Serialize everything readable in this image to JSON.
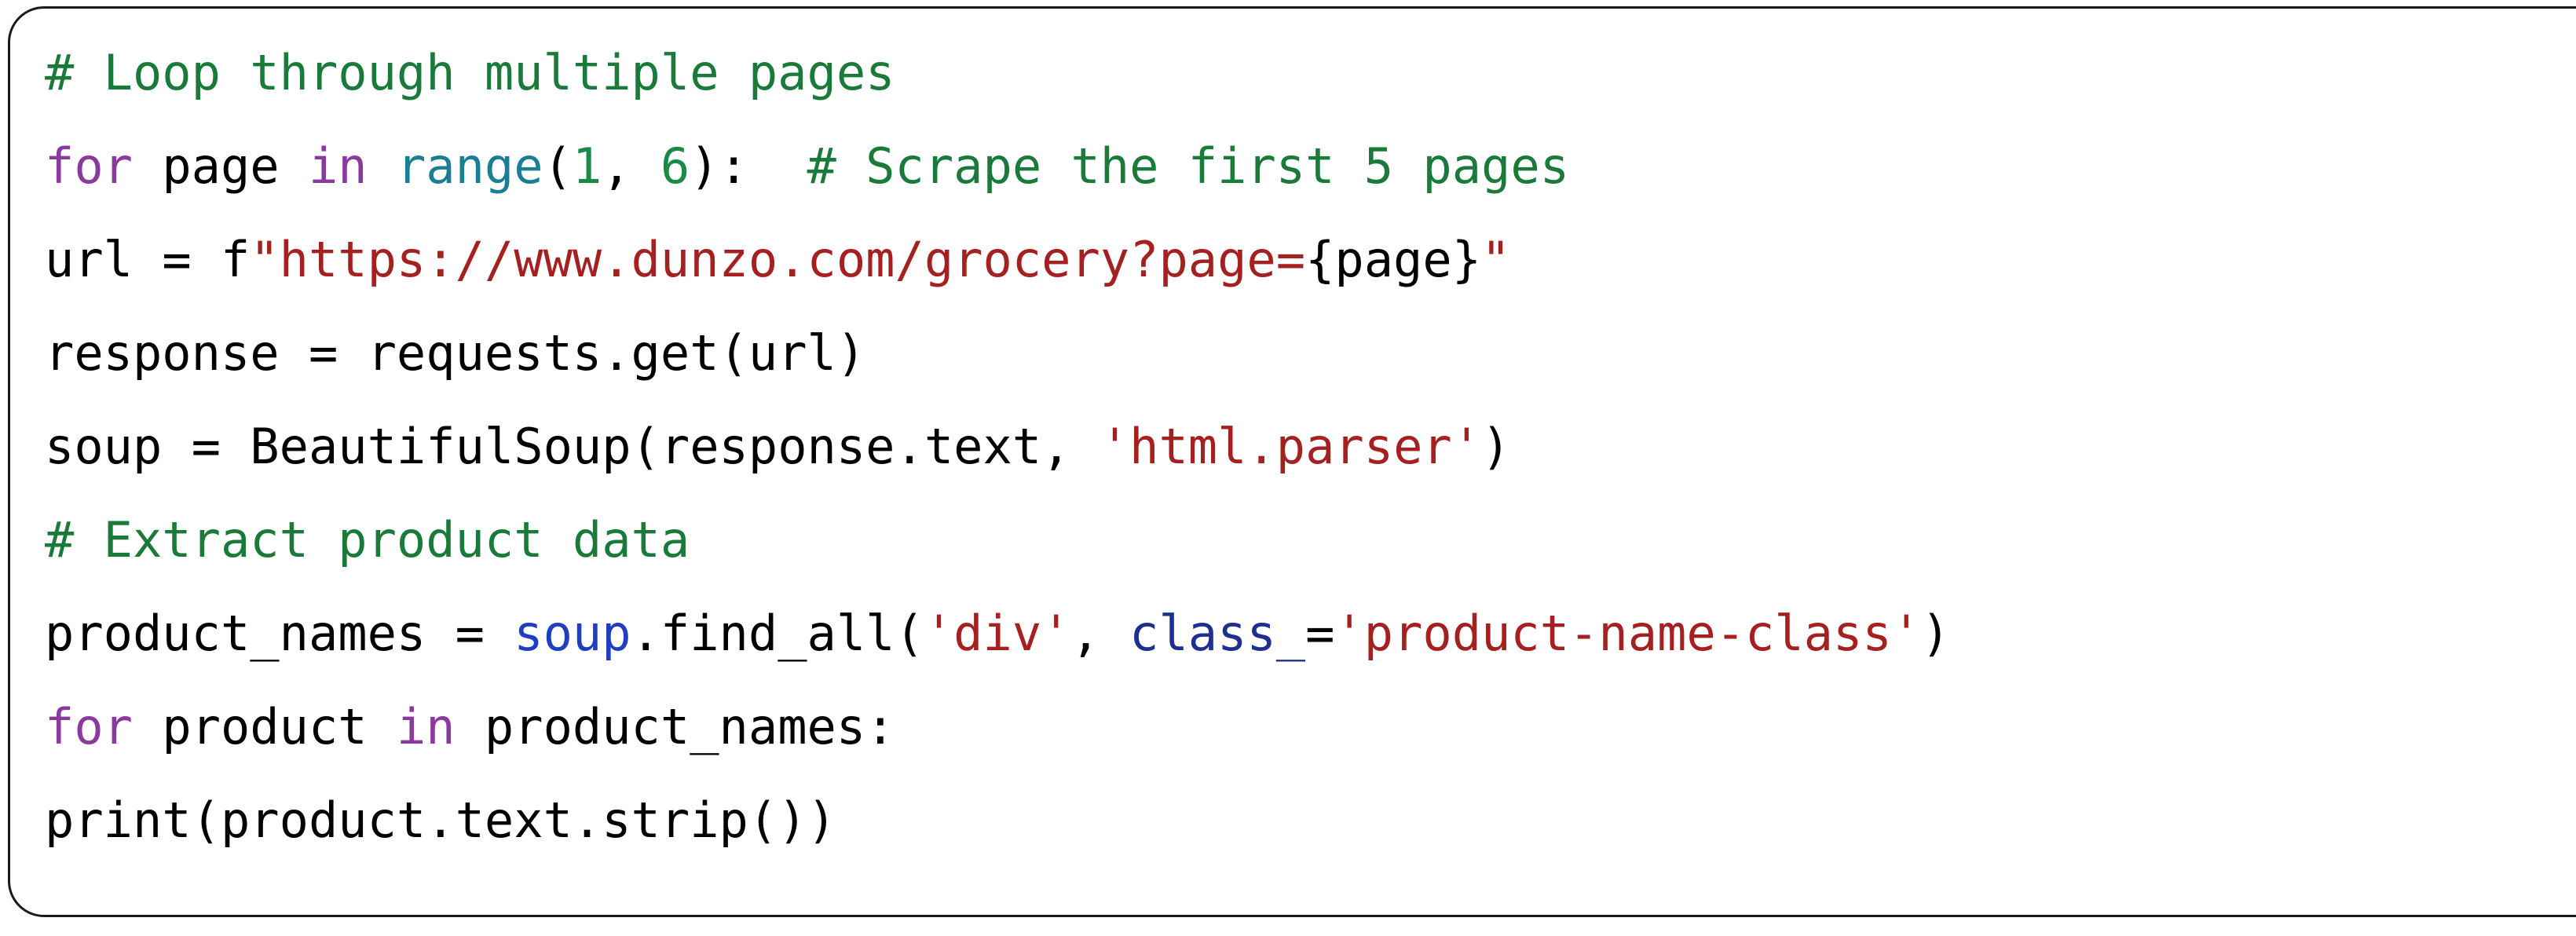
{
  "card": {
    "language": "python",
    "border_color": "#1a1a1a",
    "background_color": "#ffffff"
  },
  "colors": {
    "comment": "#1a7a3a",
    "keyword": "#8a3a9e",
    "variable": "#2b3a8c",
    "builtin": "#1a7f93",
    "number": "#1a8a4a",
    "string": "#a52121",
    "fstring_prefix": "#1f53c4",
    "interpolation": "#1f53c4",
    "kwarg": "#1f2f8f",
    "print_builtin": "#8a6d1f",
    "plain": "#000000"
  },
  "code": {
    "plain_text": "# Loop through multiple pages\nfor page in range(1, 6):  # Scrape the first 5 pages\nurl = f\"https://www.dunzo.com/grocery?page={page}\"\nresponse = requests.get(url)\nsoup = BeautifulSoup(response.text, 'html.parser')\n# Extract product data\nproduct_names = soup.find_all('div', class_='product-name-class')\nfor product in product_names:\nprint(product.text.strip())",
    "lines": [
      {
        "index": 1,
        "text": "# Loop through multiple pages",
        "tokens": [
          {
            "t": "# Loop through multiple pages",
            "c": "comment"
          }
        ]
      },
      {
        "index": 2,
        "text": "for page in range(1, 6):  # Scrape the first 5 pages",
        "tokens": [
          {
            "t": "for",
            "c": "keyword"
          },
          {
            "t": " ",
            "c": "plain"
          },
          {
            "t": "page",
            "c": "variable"
          },
          {
            "t": " ",
            "c": "plain"
          },
          {
            "t": "in",
            "c": "keyword"
          },
          {
            "t": " ",
            "c": "plain"
          },
          {
            "t": "range",
            "c": "builtin"
          },
          {
            "t": "(",
            "c": "plain"
          },
          {
            "t": "1",
            "c": "number"
          },
          {
            "t": ", ",
            "c": "plain"
          },
          {
            "t": "6",
            "c": "number"
          },
          {
            "t": "):",
            "c": "plain"
          },
          {
            "t": "  ",
            "c": "plain"
          },
          {
            "t": "# Scrape the first 5 pages",
            "c": "comment"
          }
        ]
      },
      {
        "index": 3,
        "text": "url = f\"https://www.dunzo.com/grocery?page={page}\"",
        "tokens": [
          {
            "t": "url",
            "c": "variable"
          },
          {
            "t": " ",
            "c": "plain"
          },
          {
            "t": "=",
            "c": "plain"
          },
          {
            "t": " ",
            "c": "plain"
          },
          {
            "t": "f",
            "c": "fstring_prefix"
          },
          {
            "t": "\"https://www.dunzo.com/grocery?page=",
            "c": "string"
          },
          {
            "t": "{page}",
            "c": "interpolation"
          },
          {
            "t": "\"",
            "c": "string"
          }
        ]
      },
      {
        "index": 4,
        "text": "response = requests.get(url)",
        "tokens": [
          {
            "t": "response",
            "c": "variable"
          },
          {
            "t": " = ",
            "c": "plain"
          },
          {
            "t": "requests.get(",
            "c": "plain"
          },
          {
            "t": "url",
            "c": "variable"
          },
          {
            "t": ")",
            "c": "plain"
          }
        ]
      },
      {
        "index": 5,
        "text": "soup = BeautifulSoup(response.text, 'html.parser')",
        "tokens": [
          {
            "t": "soup",
            "c": "variable"
          },
          {
            "t": " = ",
            "c": "plain"
          },
          {
            "t": "BeautifulSoup(",
            "c": "plain"
          },
          {
            "t": "response",
            "c": "variable"
          },
          {
            "t": ".text, ",
            "c": "plain"
          },
          {
            "t": "'html.parser'",
            "c": "string"
          },
          {
            "t": ")",
            "c": "plain"
          }
        ]
      },
      {
        "index": 6,
        "text": "# Extract product data",
        "tokens": [
          {
            "t": "# Extract product data",
            "c": "comment"
          }
        ]
      },
      {
        "index": 7,
        "text": "product_names = soup.find_all('div', class_='product-name-class')",
        "tokens": [
          {
            "t": "product_names",
            "c": "variable"
          },
          {
            "t": " = ",
            "c": "plain"
          },
          {
            "t": "soup",
            "c": "soup"
          },
          {
            "t": ".find_all(",
            "c": "plain"
          },
          {
            "t": "'div'",
            "c": "string"
          },
          {
            "t": ", ",
            "c": "plain"
          },
          {
            "t": "class_",
            "c": "kwarg"
          },
          {
            "t": "=",
            "c": "plain"
          },
          {
            "t": "'product-name-class'",
            "c": "string"
          },
          {
            "t": ")",
            "c": "plain"
          }
        ]
      },
      {
        "index": 8,
        "text": "for product in product_names:",
        "tokens": [
          {
            "t": "for",
            "c": "keyword"
          },
          {
            "t": " ",
            "c": "plain"
          },
          {
            "t": "product",
            "c": "variable"
          },
          {
            "t": " ",
            "c": "plain"
          },
          {
            "t": "in",
            "c": "keyword"
          },
          {
            "t": " ",
            "c": "plain"
          },
          {
            "t": "product_names",
            "c": "variable"
          },
          {
            "t": ":",
            "c": "plain"
          }
        ]
      },
      {
        "index": 9,
        "text": "print(product.text.strip())",
        "tokens": [
          {
            "t": "print",
            "c": "print_builtin"
          },
          {
            "t": "(",
            "c": "plain"
          },
          {
            "t": "product",
            "c": "variable"
          },
          {
            "t": ".text.strip())",
            "c": "plain"
          }
        ]
      }
    ]
  }
}
